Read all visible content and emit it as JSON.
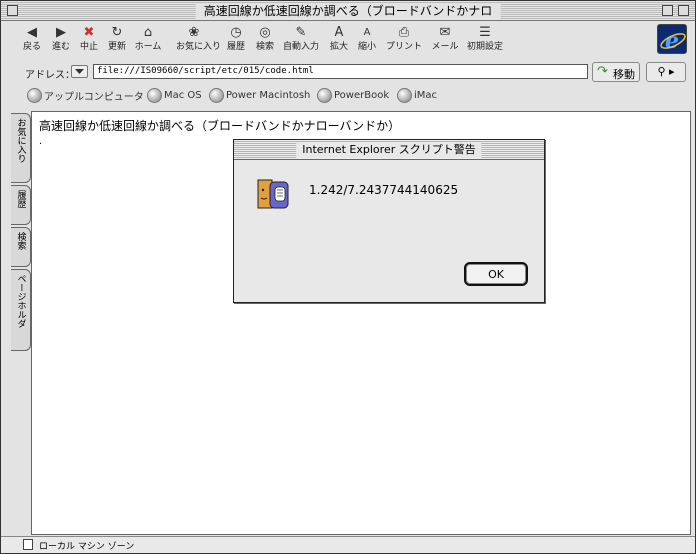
{
  "window": {
    "title": "高速回線か低速回線か調べる（ブロードバンドかナロ"
  },
  "toolbar": {
    "buttons": [
      {
        "label": "戻る",
        "icon": "back-arrow-icon"
      },
      {
        "label": "進む",
        "icon": "forward-arrow-icon"
      },
      {
        "label": "中止",
        "icon": "stop-icon"
      },
      {
        "label": "更新",
        "icon": "refresh-icon"
      },
      {
        "label": "ホーム",
        "icon": "home-icon"
      },
      {
        "label": "お気に入り",
        "icon": "favorites-icon"
      },
      {
        "label": "履歴",
        "icon": "history-icon"
      },
      {
        "label": "検索",
        "icon": "search-icon"
      },
      {
        "label": "自動入力",
        "icon": "autofill-icon"
      },
      {
        "label": "拡大",
        "icon": "enlarge-text-icon"
      },
      {
        "label": "縮小",
        "icon": "shrink-text-icon"
      },
      {
        "label": "プリント",
        "icon": "print-icon"
      },
      {
        "label": "メール",
        "icon": "mail-icon"
      },
      {
        "label": "初期設定",
        "icon": "preferences-icon"
      }
    ]
  },
  "address": {
    "label": "アドレス：",
    "url": "file:///IS09660/script/etc/015/code.html",
    "go_label": "移動"
  },
  "favorites": [
    {
      "label": "アップルコンピュータ"
    },
    {
      "label": "Mac OS"
    },
    {
      "label": "Power Macintosh"
    },
    {
      "label": "PowerBook"
    },
    {
      "label": "iMac"
    }
  ],
  "sidetabs": [
    {
      "label": "お気に入り"
    },
    {
      "label": "履歴"
    },
    {
      "label": "検索"
    },
    {
      "label": "ページホルダ"
    }
  ],
  "page": {
    "heading": "高速回線か低速回線か調べる（ブロードバンドかナローバンドか）",
    "dot": "."
  },
  "dialog": {
    "title": "Internet Explorer スクリプト警告",
    "message": "1.242/7.2437744140625",
    "ok_label": "OK"
  },
  "status": {
    "text": "ローカル マシン ゾーン"
  },
  "colors": {
    "ie_logo_bg": "#0b2a70",
    "ie_logo_fg": "#4fa3ff",
    "go_arrow": "#3a8a3a"
  }
}
